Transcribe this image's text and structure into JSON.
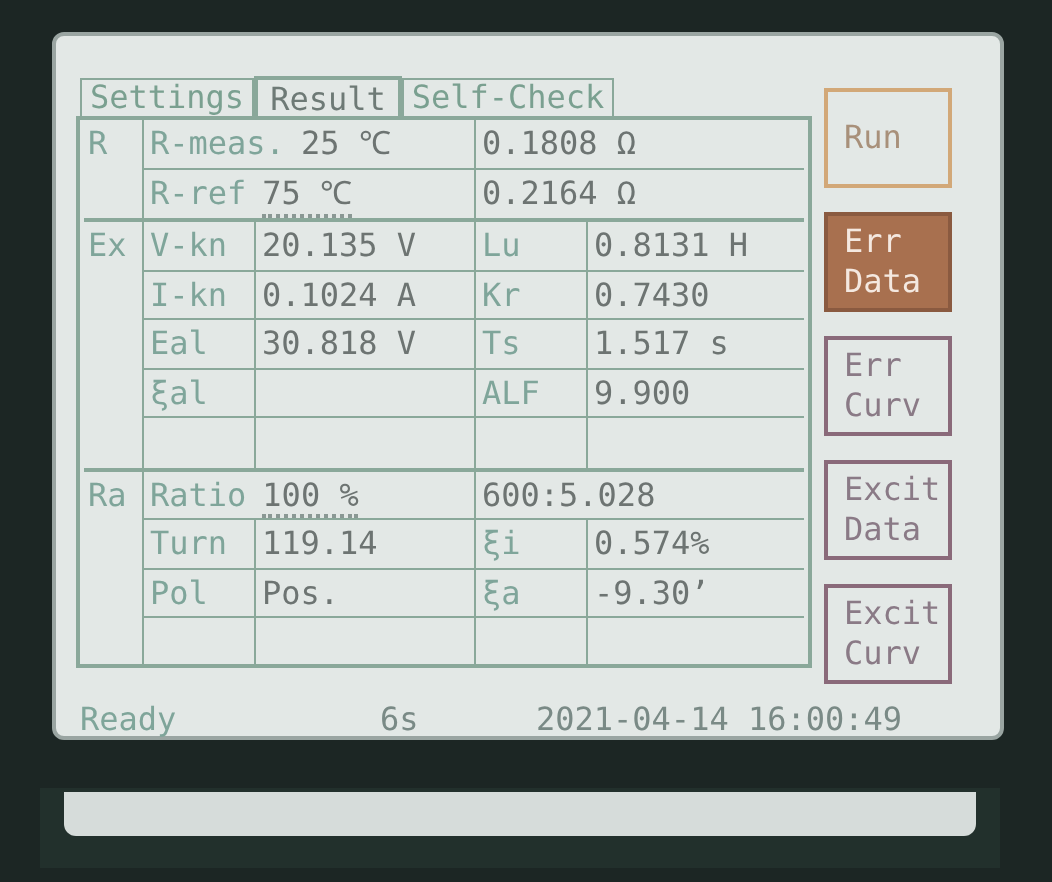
{
  "tabs": [
    {
      "label": "Settings",
      "selected": false
    },
    {
      "label": "Result",
      "selected": true
    },
    {
      "label": "Self-Check",
      "selected": false
    }
  ],
  "groups": [
    {
      "label": "R",
      "rows": [
        {
          "kind": "span",
          "name": "R-meas.",
          "setting": "25",
          "unit": "℃",
          "editable": false,
          "value": "0.1808 Ω"
        },
        {
          "kind": "span",
          "name": "R-ref",
          "setting": "75",
          "unit": "℃",
          "editable": true,
          "value": "0.2164 Ω"
        }
      ]
    },
    {
      "label": "Ex",
      "rows": [
        {
          "kind": "grid",
          "cells": [
            "V-kn",
            "20.135 V",
            "Lu",
            "0.8131 H"
          ]
        },
        {
          "kind": "grid",
          "cells": [
            "I-kn",
            "0.1024 A",
            "Kr",
            "0.7430"
          ]
        },
        {
          "kind": "grid",
          "cells": [
            "Eal",
            "30.818 V",
            "Ts",
            "1.517 s"
          ]
        },
        {
          "kind": "grid",
          "cells": [
            "ξal",
            "",
            "ALF",
            "9.900"
          ]
        },
        {
          "kind": "blank"
        }
      ]
    },
    {
      "label": "Ra",
      "rows": [
        {
          "kind": "span",
          "name": "Ratio",
          "setting": "100",
          "unit": "%",
          "editable": true,
          "value": "600:5.028"
        },
        {
          "kind": "grid",
          "cells": [
            "Turn",
            "119.14",
            "ξi",
            "0.574%"
          ]
        },
        {
          "kind": "grid",
          "cells": [
            "Pol",
            "Pos.",
            "ξa",
            "-9.30’"
          ]
        },
        {
          "kind": "blank"
        }
      ]
    }
  ],
  "buttons": [
    {
      "lines": [
        "Run"
      ],
      "selected": false
    },
    {
      "lines": [
        "Err",
        "Data"
      ],
      "selected": true
    },
    {
      "lines": [
        "Err",
        "Curv"
      ],
      "selected": false
    },
    {
      "lines": [
        "Excit",
        "Data"
      ],
      "selected": false
    },
    {
      "lines": [
        "Excit",
        "Curv"
      ],
      "selected": false
    }
  ],
  "status_bar": {
    "state": "Ready",
    "elapsed": "6s",
    "datetime": "2021-04-14 16:00:49"
  }
}
